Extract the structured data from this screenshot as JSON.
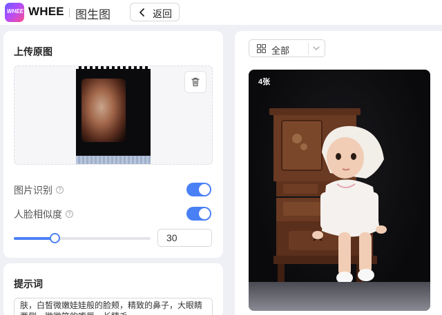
{
  "header": {
    "logo_text": "WHEE",
    "brand": "WHEE",
    "page_name": "图生图",
    "back_label": "返回"
  },
  "upload": {
    "title": "上传原图"
  },
  "options": {
    "recognize_label": "图片识别",
    "recognize_on": true,
    "similarity_label": "人脸相似度",
    "similarity_on": true,
    "similarity_value": "30",
    "similarity_fraction": 0.3
  },
  "prompt": {
    "title": "提示词",
    "text": "肤，白皙微嫩娃娃般的脸颊，精致的鼻子，大眼睛两侧，微微笑的嘴唇，长睫毛"
  },
  "results": {
    "filter_label": "全部",
    "count_label": "4张"
  },
  "colors": {
    "accent": "#4a80f5"
  }
}
